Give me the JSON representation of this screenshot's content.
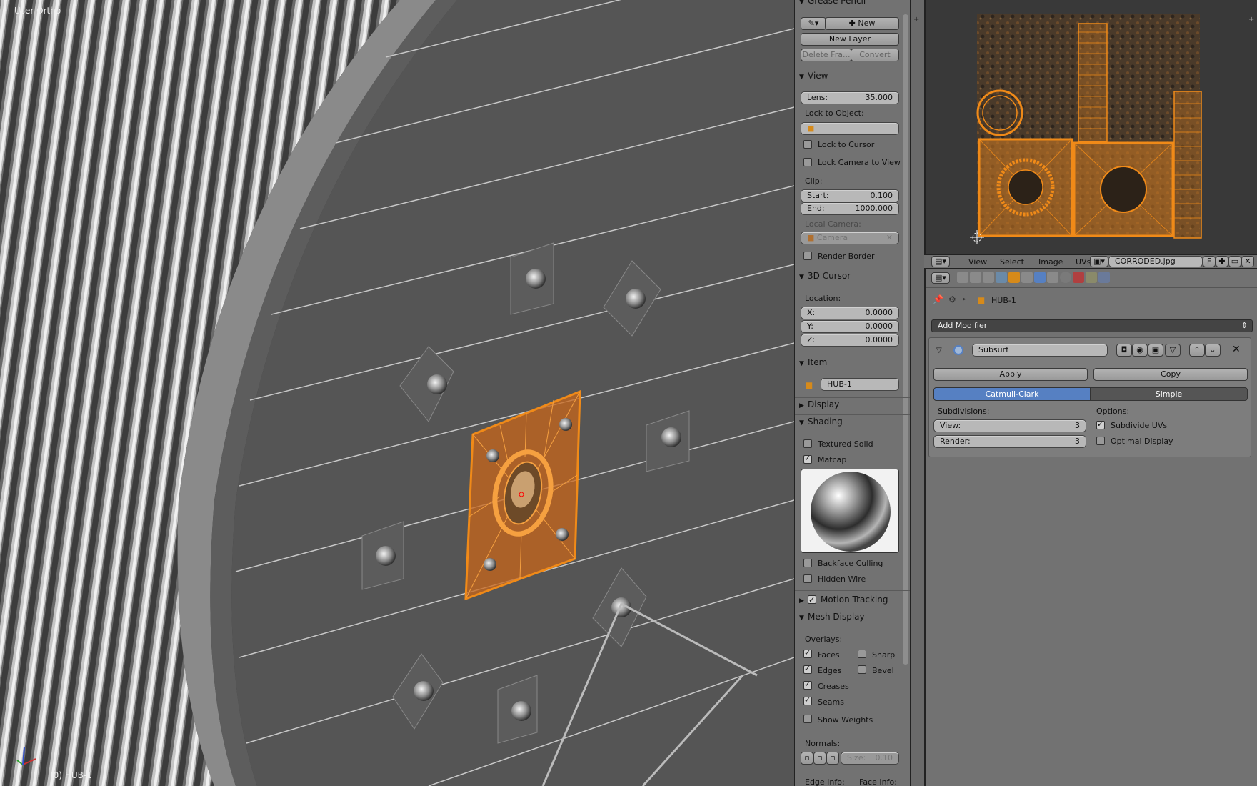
{
  "viewport": {
    "title": "User Ortho",
    "status": "(0) HUB-1"
  },
  "npanel": {
    "grease_pencil": {
      "header": "Grease Pencil",
      "new_label": "New",
      "new_layer_label": "New Layer",
      "delete_frame_label": "Delete Fra...",
      "convert_label": "Convert"
    },
    "view": {
      "header": "View",
      "lens_label": "Lens:",
      "lens_value": "35.000",
      "lock_to_object_label": "Lock to Object:",
      "lock_to_cursor": "Lock to Cursor",
      "lock_camera_to_view": "Lock Camera to View",
      "clip_label": "Clip:",
      "start_label": "Start:",
      "start_value": "0.100",
      "end_label": "End:",
      "end_value": "1000.000",
      "local_camera_label": "Local Camera:",
      "camera_value": "Camera",
      "render_border": "Render Border"
    },
    "cursor": {
      "header": "3D Cursor",
      "location_label": "Location:",
      "x_label": "X:",
      "x_value": "0.0000",
      "y_label": "Y:",
      "y_value": "0.0000",
      "z_label": "Z:",
      "z_value": "0.0000"
    },
    "item": {
      "header": "Item",
      "name": "HUB-1"
    },
    "display": {
      "header": "Display"
    },
    "shading": {
      "header": "Shading",
      "textured_solid": "Textured Solid",
      "matcap": "Matcap",
      "backface_culling": "Backface Culling",
      "hidden_wire": "Hidden Wire"
    },
    "motion_tracking": {
      "header": "Motion Tracking"
    },
    "mesh_display": {
      "header": "Mesh Display",
      "overlays_label": "Overlays:",
      "faces": "Faces",
      "sharp": "Sharp",
      "edges": "Edges",
      "bevel": "Bevel",
      "creases": "Creases",
      "seams": "Seams",
      "show_weights": "Show Weights",
      "normals_label": "Normals:",
      "size_label": "Size:",
      "size_value": "0.10",
      "edge_info": "Edge Info:",
      "face_info": "Face Info:"
    }
  },
  "image_editor": {
    "menu": [
      "View",
      "Select",
      "Image",
      "UVs"
    ],
    "image_name": "CORRODED.jpg",
    "fake_user": "F"
  },
  "properties": {
    "object_name": "HUB-1",
    "add_modifier_label": "Add Modifier",
    "modifier": {
      "name": "Subsurf",
      "apply_label": "Apply",
      "copy_label": "Copy",
      "type_catmull": "Catmull-Clark",
      "type_simple": "Simple",
      "subdivisions_label": "Subdivisions:",
      "view_label": "View:",
      "view_value": "3",
      "render_label": "Render:",
      "render_value": "3",
      "options_label": "Options:",
      "subdivide_uvs": "Subdivide UVs",
      "optimal_display": "Optimal Display"
    }
  },
  "colors": {
    "selection_orange": "#f08a18",
    "active_tab_blue": "#5680c2",
    "viewport_bg": "#3d3d3d",
    "panel_bg": "#727272"
  }
}
